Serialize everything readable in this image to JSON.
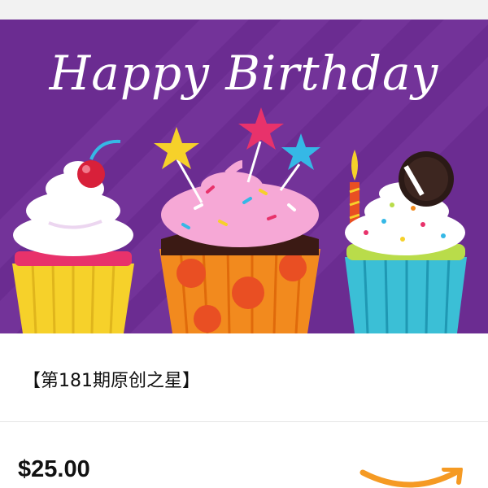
{
  "card": {
    "greeting": "Happy Birthday",
    "title": "【第181期原创之星】",
    "price": "$25.00",
    "background_color": "#6b2c91",
    "logo_icon": "amazon-smile-icon",
    "logo_color": "#f59a23"
  }
}
